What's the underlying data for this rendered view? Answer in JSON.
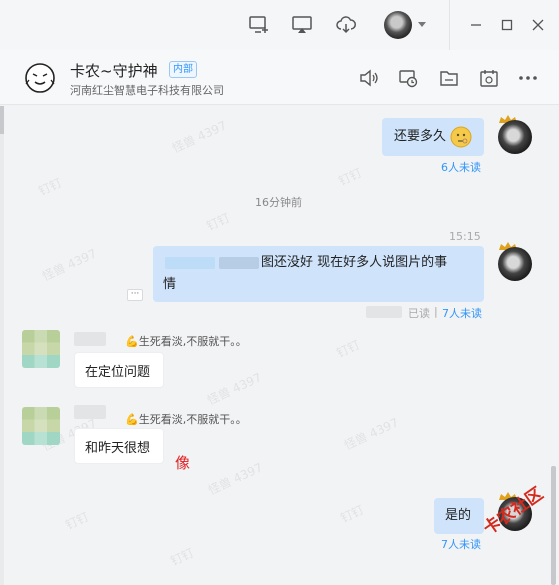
{
  "window": {
    "toolbar_icons": [
      "add-screen-icon",
      "screen-share-icon",
      "cloud-icon",
      "avatar",
      "minimize-icon",
      "maximize-icon",
      "close-icon"
    ]
  },
  "chat": {
    "title": "卡农~守护神",
    "badge": "内部",
    "subtitle": "河南红尘智慧电子科技有限公司",
    "header_icons": [
      "voice-icon",
      "history-icon",
      "folder-icon",
      "calendar-icon",
      "more-icon"
    ]
  },
  "messages": [
    {
      "direction": "out",
      "text": "还要多久",
      "emoji": "thinking-emoji",
      "status": "6人未读"
    },
    {
      "direction": "divider",
      "text": "16分钟前"
    },
    {
      "direction": "out",
      "time": "15:15",
      "text_part": "图还没好 现在好多人说图片的事",
      "text_line2": "情",
      "status_read": "已读",
      "status_sep": "|",
      "status_unread": "7人未读"
    },
    {
      "direction": "in",
      "signature": "💪生死看淡,不服就干。。",
      "text": "在定位问题"
    },
    {
      "direction": "in",
      "signature": "💪生死看淡,不服就干。。",
      "text": "和昨天很想"
    },
    {
      "direction": "out",
      "text": "是的",
      "status": "7人未读"
    }
  ],
  "annotation": {
    "red_char": "像"
  },
  "watermarks": {
    "company": "钉钉",
    "stamp": "怪兽 4397"
  },
  "brand_mark": "卡农社区",
  "colors": {
    "accent": "#3296fa",
    "bubble_out": "#cfe3fb",
    "annotation_red": "#e02020"
  }
}
